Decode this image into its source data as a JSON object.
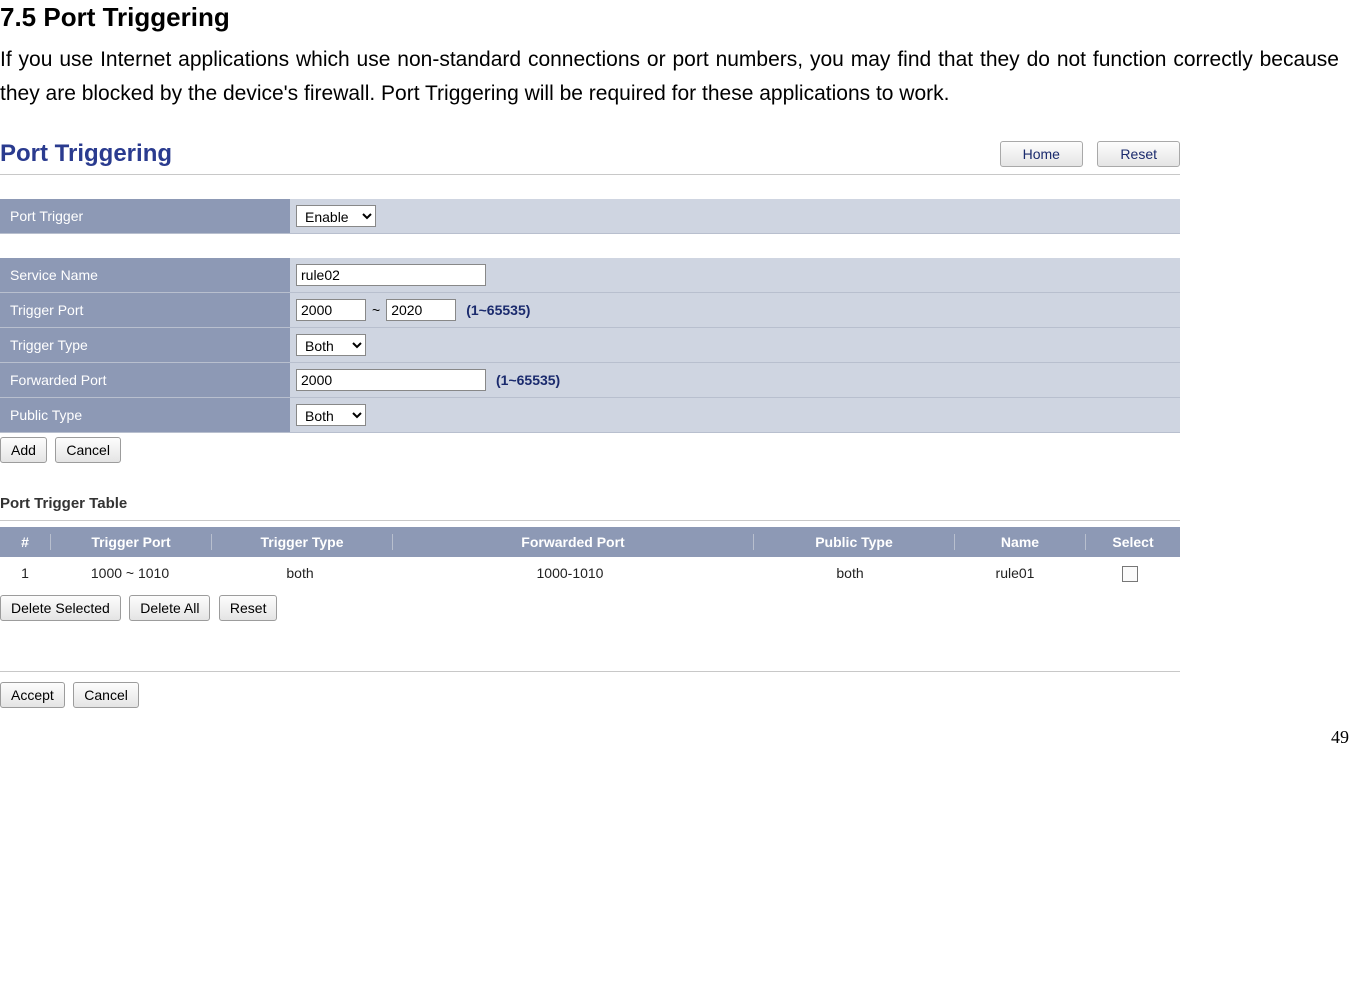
{
  "doc": {
    "heading": "7.5   Port Triggering",
    "para": "If you use Internet applications which use non-standard connections or port numbers, you may find that they do not function correctly because they are blocked by the device's firewall. Port Triggering will be required for these applications to work.",
    "page_number": "49"
  },
  "app": {
    "title": "Port Triggering",
    "home_btn": "Home",
    "reset_btn": "Reset"
  },
  "form": {
    "port_trigger_label": "Port Trigger",
    "port_trigger_value": "Enable",
    "service_name_label": "Service Name",
    "service_name_value": "rule02",
    "trigger_port_label": "Trigger Port",
    "trigger_port_from": "2000",
    "trigger_port_to": "2020",
    "trigger_port_hint": "(1~65535)",
    "trigger_type_label": "Trigger Type",
    "trigger_type_value": "Both",
    "forwarded_port_label": "Forwarded Port",
    "forwarded_port_value": "2000",
    "forwarded_port_hint": "(1~65535)",
    "public_type_label": "Public Type",
    "public_type_value": "Both",
    "add_btn": "Add",
    "cancel_btn": "Cancel"
  },
  "table": {
    "title": "Port Trigger Table",
    "headers": {
      "idx": "#",
      "trigger_port": "Trigger Port",
      "trigger_type": "Trigger Type",
      "forwarded_port": "Forwarded Port",
      "public_type": "Public Type",
      "name": "Name",
      "select": "Select"
    },
    "rows": [
      {
        "idx": "1",
        "trigger_port": "1000 ~ 1010",
        "trigger_type": "both",
        "forwarded_port": "1000-1010",
        "public_type": "both",
        "name": "rule01"
      }
    ],
    "delete_selected_btn": "Delete Selected",
    "delete_all_btn": "Delete All",
    "reset_btn": "Reset"
  },
  "footer": {
    "accept_btn": "Accept",
    "cancel_btn": "Cancel"
  }
}
